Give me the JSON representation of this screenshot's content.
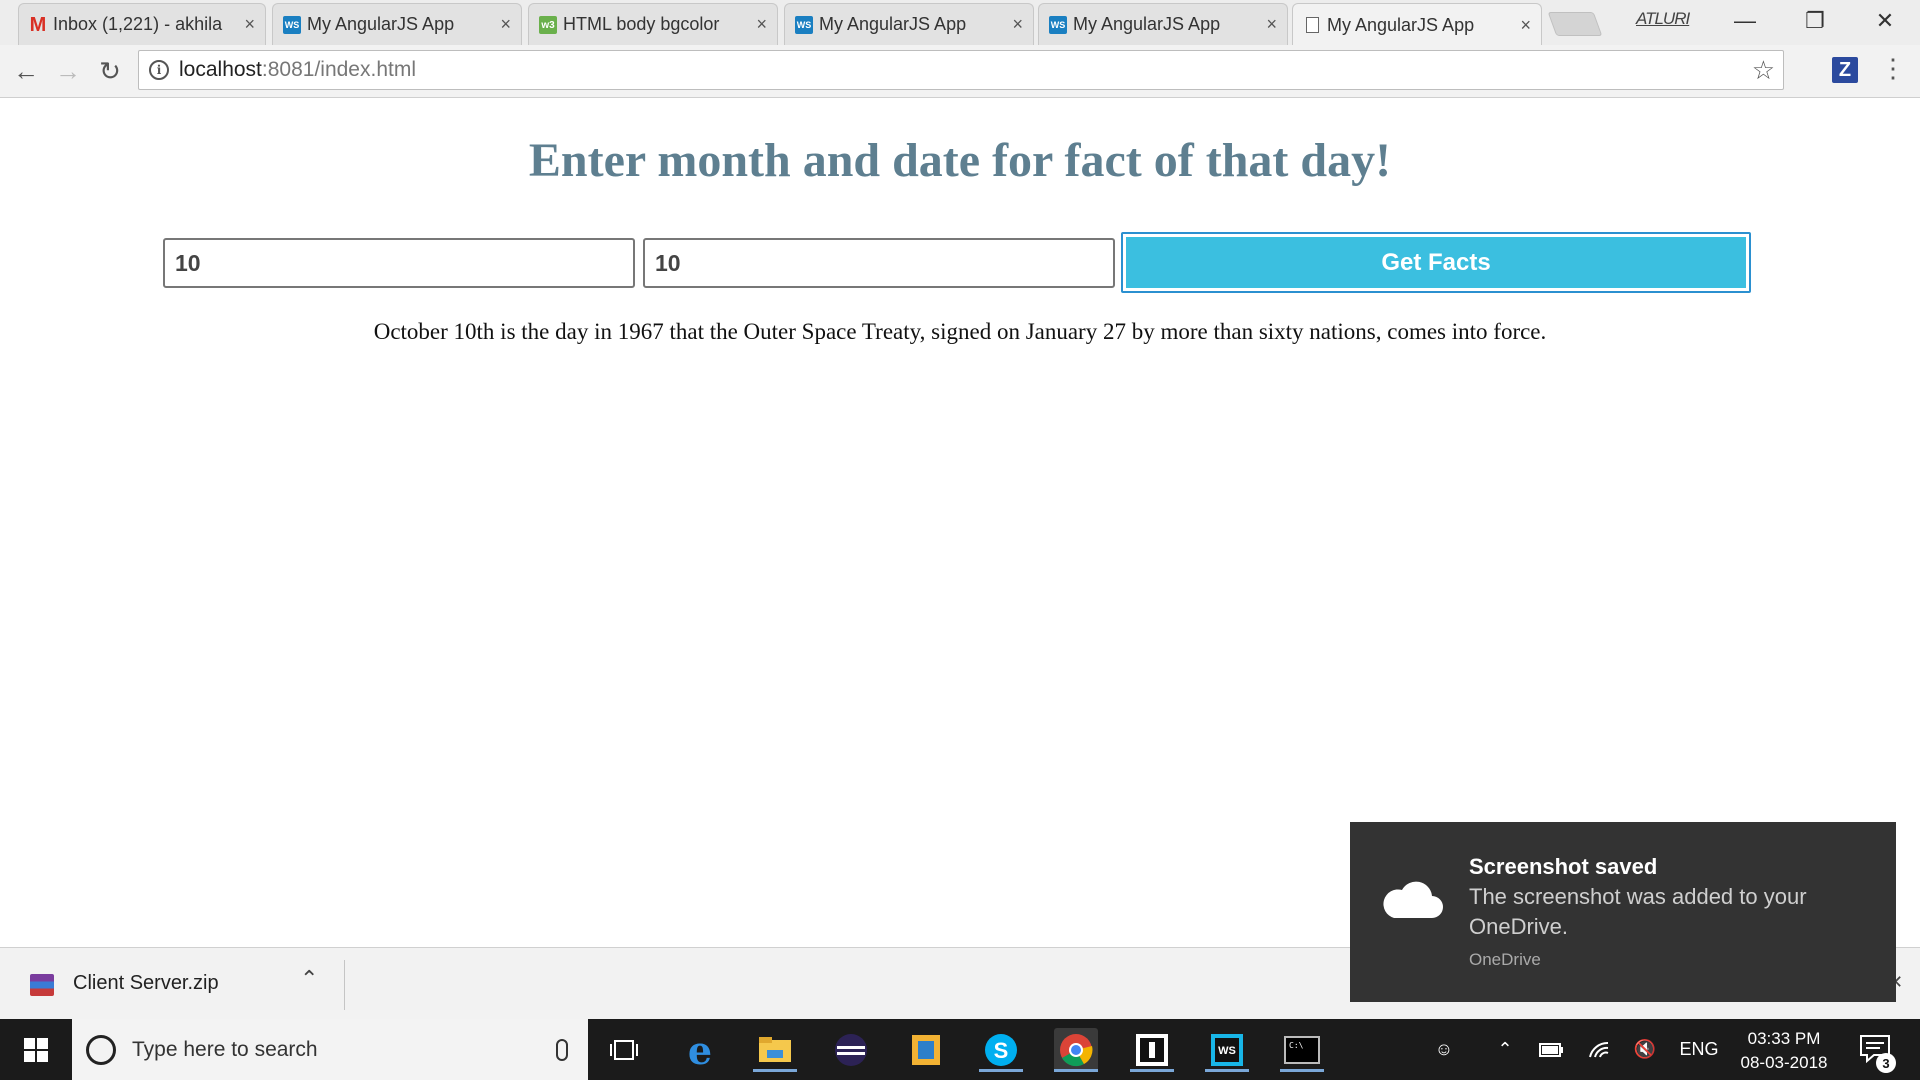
{
  "browser": {
    "tabs": [
      {
        "title": "Inbox (1,221) - akhila",
        "icon": "gmail-icon"
      },
      {
        "title": "My AngularJS App",
        "icon": "webstorm-icon"
      },
      {
        "title": "HTML body bgcolor",
        "icon": "w3schools-icon"
      },
      {
        "title": "My AngularJS App",
        "icon": "webstorm-icon"
      },
      {
        "title": "My AngularJS App",
        "icon": "webstorm-icon"
      },
      {
        "title": "My AngularJS App",
        "icon": "document-icon"
      }
    ],
    "close_glyph": "×",
    "profile_name": "ATLURI",
    "url_host": "localhost",
    "url_rest": ":8081/index.html",
    "extension_letter": "Z"
  },
  "page": {
    "title": "Enter month and date for fact of that day!",
    "month_value": "10",
    "date_value": "10",
    "button_label": "Get Facts",
    "fact_text": "October 10th is the day in 1967 that the Outer Space Treaty, signed on January 27 by more than sixty nations, comes into force."
  },
  "downloads": {
    "file_name": "Client Server.zip"
  },
  "toast": {
    "title": "Screenshot saved",
    "body": "The screenshot was added to your OneDrive.",
    "source": "OneDrive"
  },
  "taskbar": {
    "search_placeholder": "Type here to search",
    "language": "ENG",
    "time": "03:33 PM",
    "date": "08-03-2018",
    "notification_count": "3"
  },
  "colors": {
    "title": "#5e7f90",
    "button": "#3bbfe0",
    "toast_bg": "#333333",
    "taskbar_bg": "#1b1b1b"
  }
}
